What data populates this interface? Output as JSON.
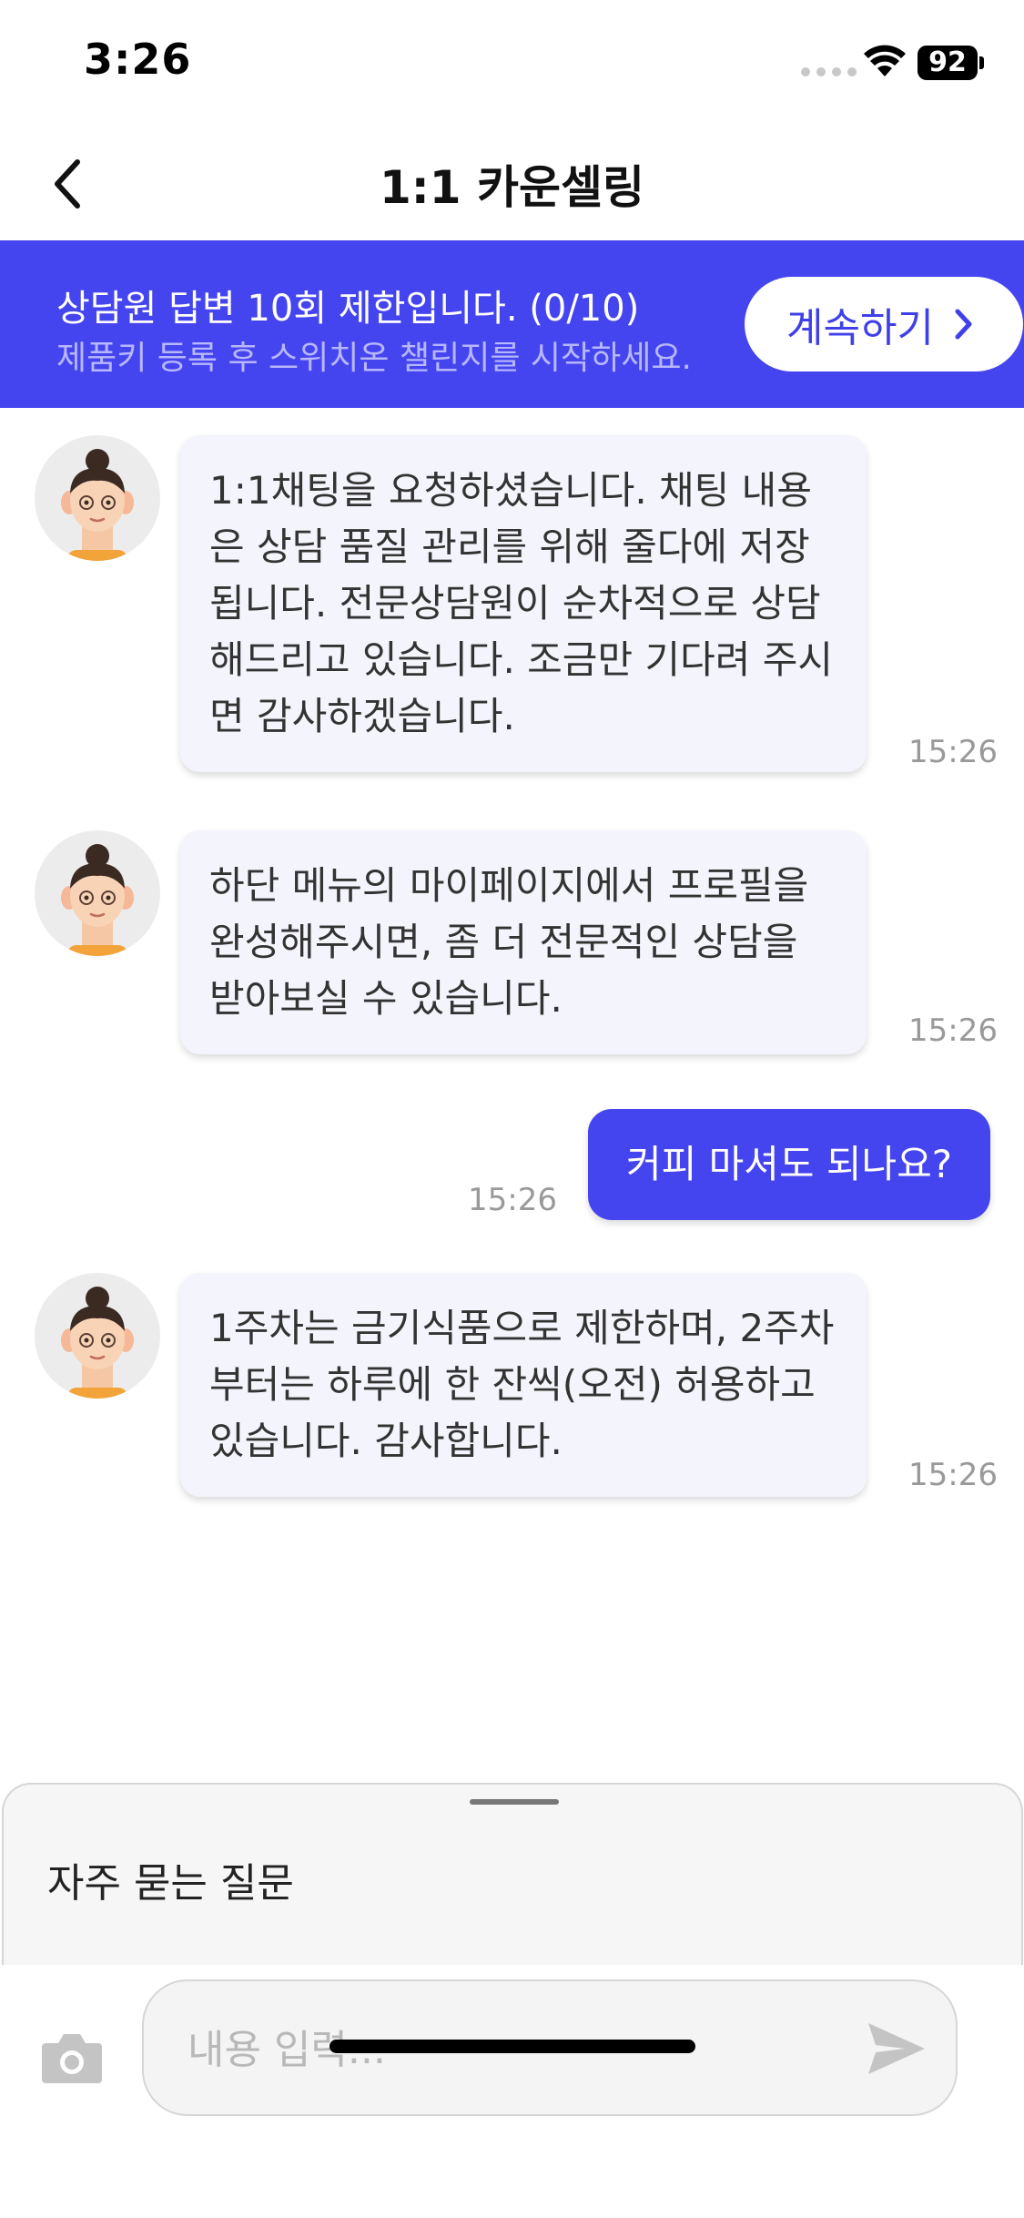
{
  "status_bar": {
    "time": "3:26",
    "battery": "92"
  },
  "nav": {
    "title": "1:1 카운셀링"
  },
  "banner": {
    "title": "상담원 답변 10회 제한입니다. (0/10)",
    "subtitle": "제품키 등록 후 스위치온 챌린지를 시작하세요.",
    "continue_label": "계속하기"
  },
  "messages": [
    {
      "from": "counselor",
      "text": "1:1채팅을 요청하셨습니다. 채팅 내용은 상담 품질 관리를 위해 줄다에 저장됩니다. 전문상담원이 순차적으로 상담해드리고 있습니다. 조금만 기다려 주시면 감사하겠습니다.",
      "time": "15:26"
    },
    {
      "from": "counselor",
      "text": "하단 메뉴의 마이페이지에서 프로필을 완성해주시면, 좀 더 전문적인 상담을 받아보실 수 있습니다.",
      "time": "15:26"
    },
    {
      "from": "user",
      "text": "커피 마셔도 되나요?",
      "time": "15:26"
    },
    {
      "from": "counselor",
      "text": "1주차는 금기식품으로 제한하며, 2주차 부터는 하루에 한 잔씩(오전) 허용하고 있습니다. 감사합니다.",
      "time": "15:26"
    }
  ],
  "faq": {
    "title": "자주 묻는 질문"
  },
  "composer": {
    "placeholder": "내용 입력..."
  },
  "colors": {
    "accent": "#4545f0",
    "bubble_in": "#f4f4fc"
  }
}
